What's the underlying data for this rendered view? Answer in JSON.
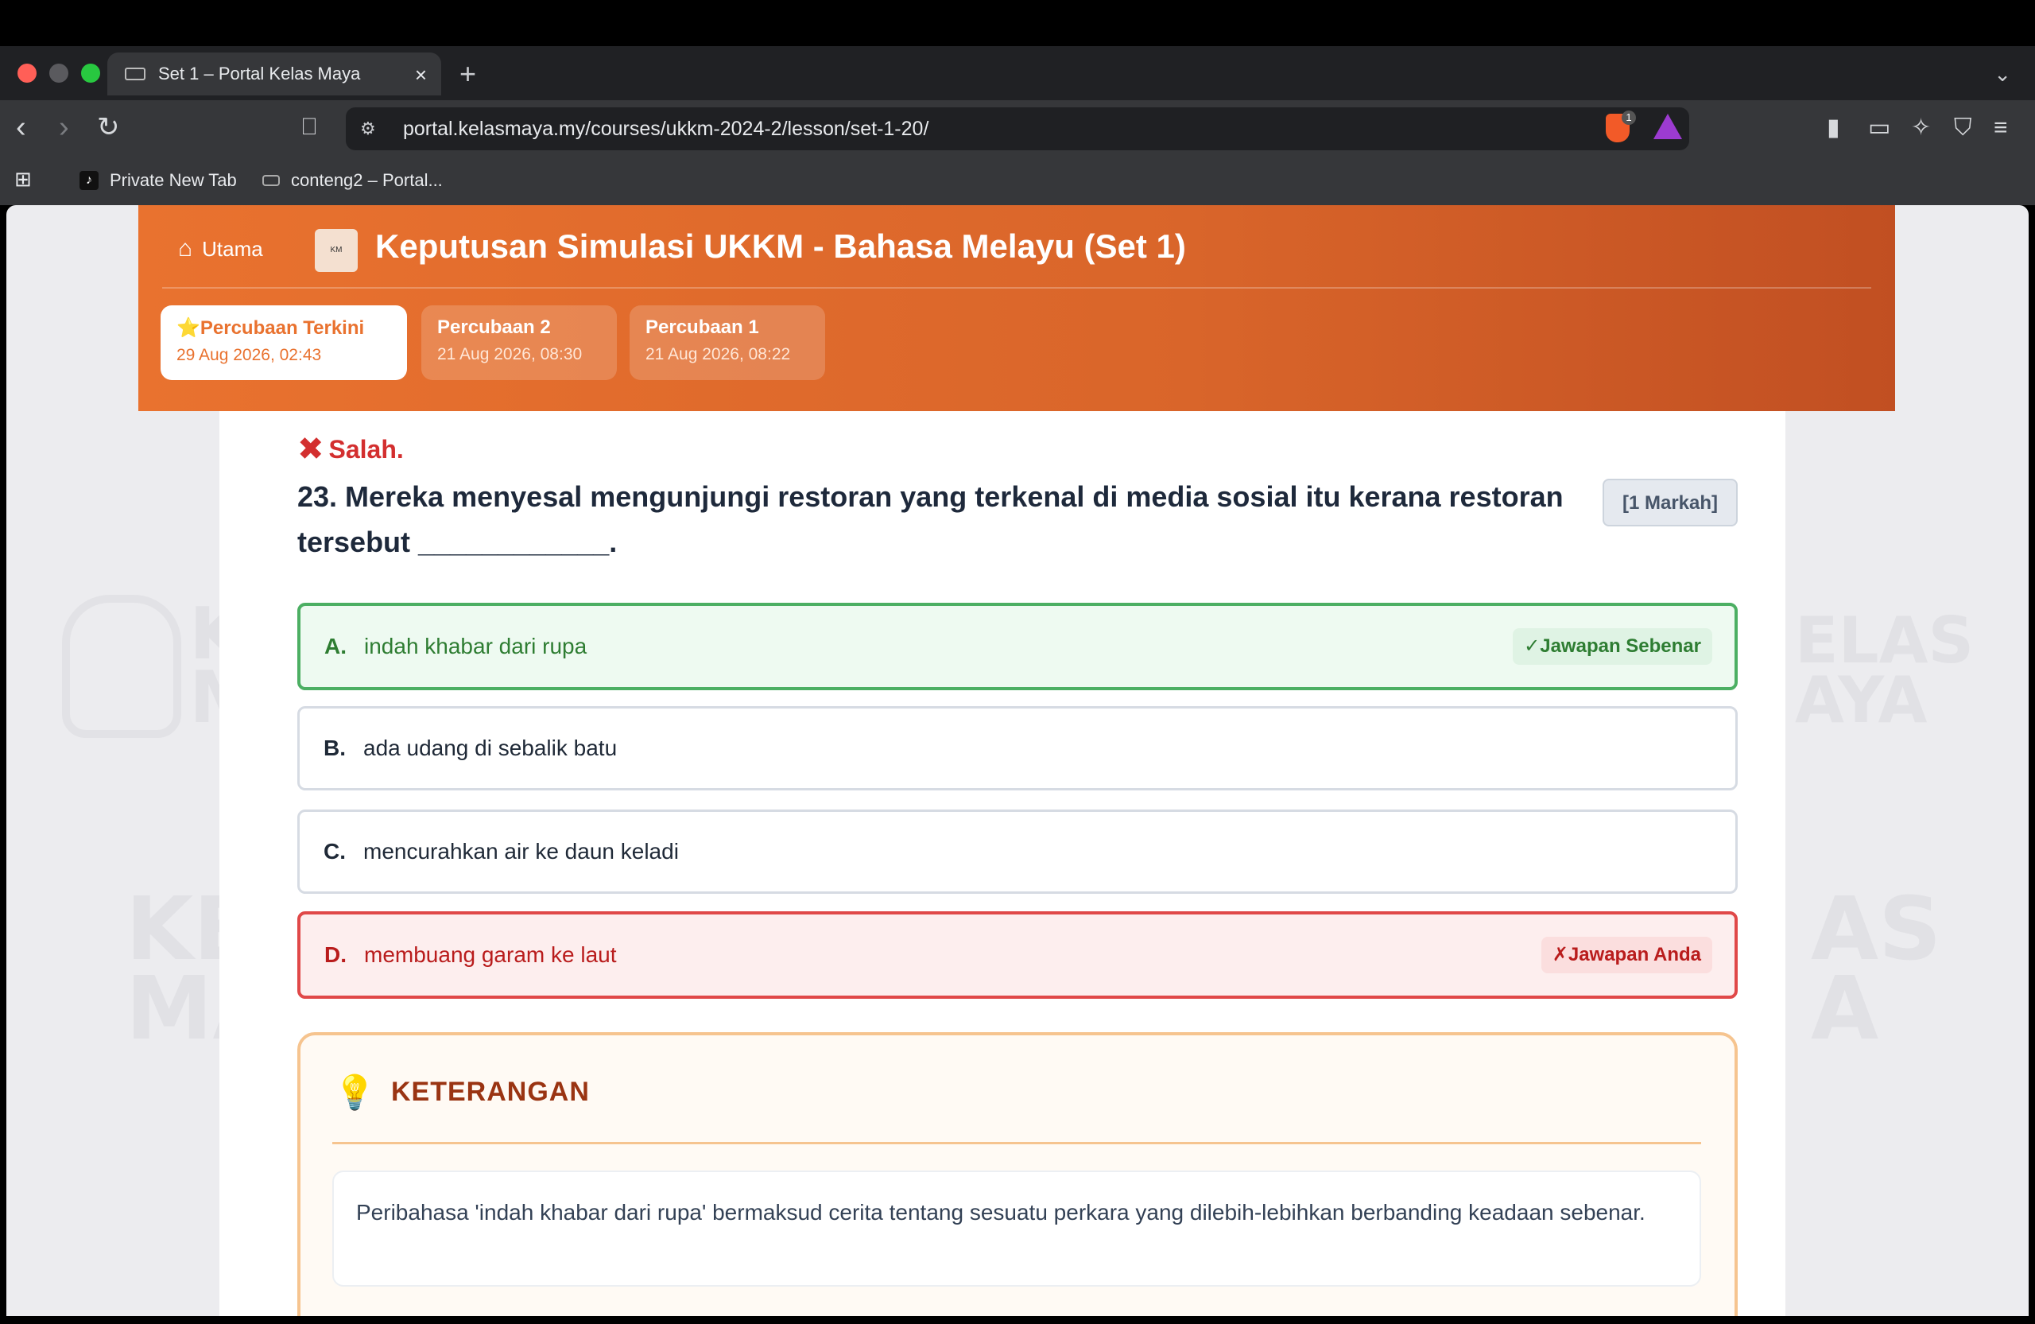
{
  "browser": {
    "tab_title": "Set 1 – Portal Kelas Maya",
    "tab_close": "×",
    "new_tab": "+",
    "url": "portal.kelasmaya.my/courses/ukkm-2024-2/lesson/set-1-20/",
    "shield_count": "1",
    "bookmarks": [
      {
        "label": "Private New Tab"
      },
      {
        "label": "conteng2 – Portal..."
      }
    ]
  },
  "header": {
    "home_label": "Utama",
    "title": "Keputusan Simulasi UKKM - Bahasa Melayu (Set 1)",
    "attempts": [
      {
        "name": "⭐Percubaan Terkini",
        "date": "29 Aug 2026, 02:43"
      },
      {
        "name": "Percubaan 2",
        "date": "21 Aug 2026, 08:30"
      },
      {
        "name": "Percubaan 1",
        "date": "21 Aug 2026, 08:22"
      }
    ]
  },
  "question": {
    "verdict": "Salah.",
    "text": "23. Mereka menyesal mengunjungi restoran yang terkenal di media sosial itu kerana restoran tersebut ____________.",
    "marks": "[1 Markah]",
    "options": [
      {
        "letter": "A.",
        "text": "indah khabar dari rupa",
        "tag": "✓Jawapan Sebenar"
      },
      {
        "letter": "B.",
        "text": "ada udang di sebalik batu"
      },
      {
        "letter": "C.",
        "text": "mencurahkan air ke daun keladi"
      },
      {
        "letter": "D.",
        "text": "membuang garam ke laut",
        "tag": "✗Jawapan Anda"
      }
    ]
  },
  "explanation": {
    "heading": "KETERANGAN",
    "body": "Peribahasa 'indah khabar dari rupa' bermaksud cerita tentang sesuatu perkara yang dilebih-lebihkan berbanding keadaan sebenar."
  },
  "watermark": {
    "left": "KE MA",
    "right": "AS A",
    "left_top": "K M",
    "right_top": "ELAS AYA"
  }
}
